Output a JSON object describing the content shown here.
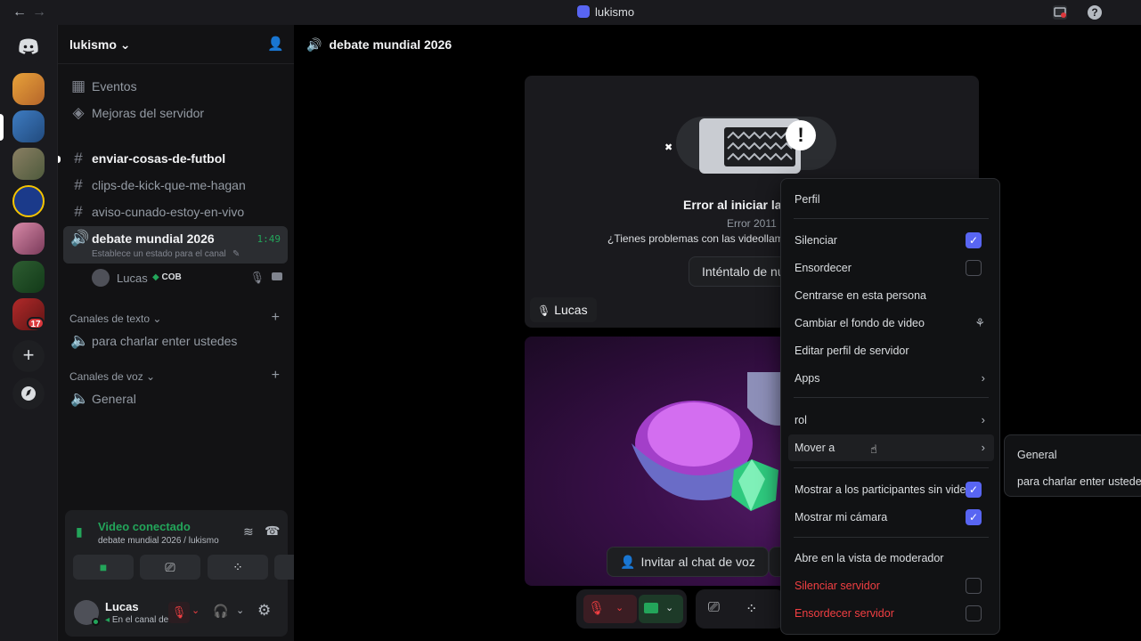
{
  "titlebar": {
    "title": "lukismo",
    "back": "←",
    "forward": "→"
  },
  "server": {
    "name": "lukismo"
  },
  "sidebar": {
    "top_items": [
      {
        "label": "Eventos"
      },
      {
        "label": "Mejoras del servidor"
      }
    ],
    "channels": [
      {
        "label": "enviar-cosas-de-futbol"
      },
      {
        "label": "clips-de-kick-que-me-hagan"
      },
      {
        "label": "aviso-cunado-estoy-en-vivo"
      }
    ],
    "voice_channel": {
      "label": "debate mundial 2026",
      "timer": "1:49",
      "status": "Establece un estado para el canal"
    },
    "voice_user": {
      "name": "Lucas",
      "tag": "COB"
    },
    "text_category": "Canales de texto",
    "text_channel": "para charlar enter ustedes",
    "voice_category": "Canales de voz",
    "voice_general": "General"
  },
  "rail": {
    "badge": "17"
  },
  "voice_panel": {
    "status": "Video conectado",
    "location": "debate mundial 2026 / lukismo",
    "user_name": "Lucas",
    "user_status": "En el canal de voz"
  },
  "main": {
    "channel_title": "debate mundial 2026",
    "error_title": "Error al iniciar la c",
    "error_code": "Error 2011",
    "error_help": "¿Tienes problemas con las videollam",
    "retry_button": "Inténtalo de nu",
    "participant_label": "Lucas",
    "invite_button": "Invitar al chat de voz"
  },
  "context_menu": {
    "items": [
      {
        "label": "Perfil"
      },
      {
        "label": "Silenciar",
        "checked": true
      },
      {
        "label": "Ensordecer",
        "checked": false
      },
      {
        "label": "Centrarse en esta persona"
      },
      {
        "label": "Cambiar el fondo de video"
      },
      {
        "label": "Editar perfil de servidor"
      },
      {
        "label": "Apps"
      },
      {
        "label": "rol"
      },
      {
        "label": "Mover a"
      },
      {
        "label": "Mostrar a los participantes sin video",
        "checked": true
      },
      {
        "label": "Mostrar mi cámara",
        "checked": true
      },
      {
        "label": "Abre en la vista de moderador"
      },
      {
        "label": "Silenciar servidor",
        "checked": false
      },
      {
        "label": "Ensordecer servidor",
        "checked": false
      }
    ]
  },
  "submenu": {
    "items": [
      {
        "label": "General"
      },
      {
        "label": "para charlar enter ustedes"
      }
    ]
  },
  "colors": {
    "accent": "#5865f2",
    "green": "#23a55a",
    "danger": "#f23f42",
    "bg": "#121214"
  }
}
